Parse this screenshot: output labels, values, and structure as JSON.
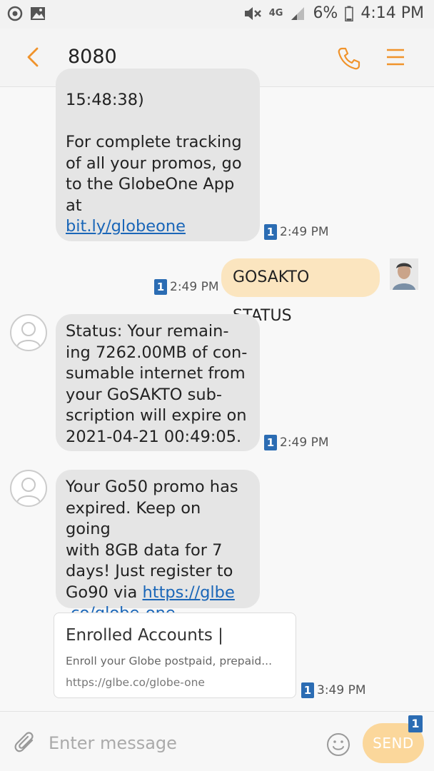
{
  "status_bar": {
    "battery": "6%",
    "time": "4:14 PM",
    "network": "4G"
  },
  "header": {
    "title": "8080"
  },
  "messages": [
    {
      "direction": "incoming",
      "lines": [
        "15:48:38)",
        "",
        "For complete tracking",
        "of all your promos, go",
        "to the GlobeOne App at"
      ],
      "link": "bit.ly/globeone",
      "sim": "1",
      "time": "2:49 PM"
    },
    {
      "direction": "outgoing",
      "text": "GOSAKTO STATUS",
      "sim": "1",
      "time": "2:49 PM"
    },
    {
      "direction": "incoming",
      "lines": [
        "Status: Your remain-",
        "ing 7262.00MB of con-",
        "sumable internet from",
        "your GoSAKTO sub-",
        "scription will expire on",
        "2021-04-21 00:49:05."
      ],
      "sim": "1",
      "time": "2:49 PM"
    },
    {
      "direction": "incoming",
      "lines": [
        "Your Go50 promo has",
        "expired. Keep on going",
        "with 8GB data for 7",
        "days! Just register to"
      ],
      "line5_prefix": "Go90 via ",
      "line5_link": "https://glbe",
      "line6_link": ".co/globe-one"
    }
  ],
  "link_preview": {
    "title": "Enrolled Accounts |",
    "description": "Enroll your Globe postpaid, prepaid...",
    "url": "https://glbe.co/globe-one",
    "sim": "1",
    "time": "3:49 PM"
  },
  "composer": {
    "placeholder": "Enter message",
    "send_label": "SEND",
    "sim_badge": "1"
  },
  "colors": {
    "accent": "#f0932b",
    "incoming_bubble": "#e5e5e5",
    "outgoing_bubble": "#fbe5bf",
    "link": "#1a66b8",
    "sim_badge": "#2b6cb3"
  }
}
